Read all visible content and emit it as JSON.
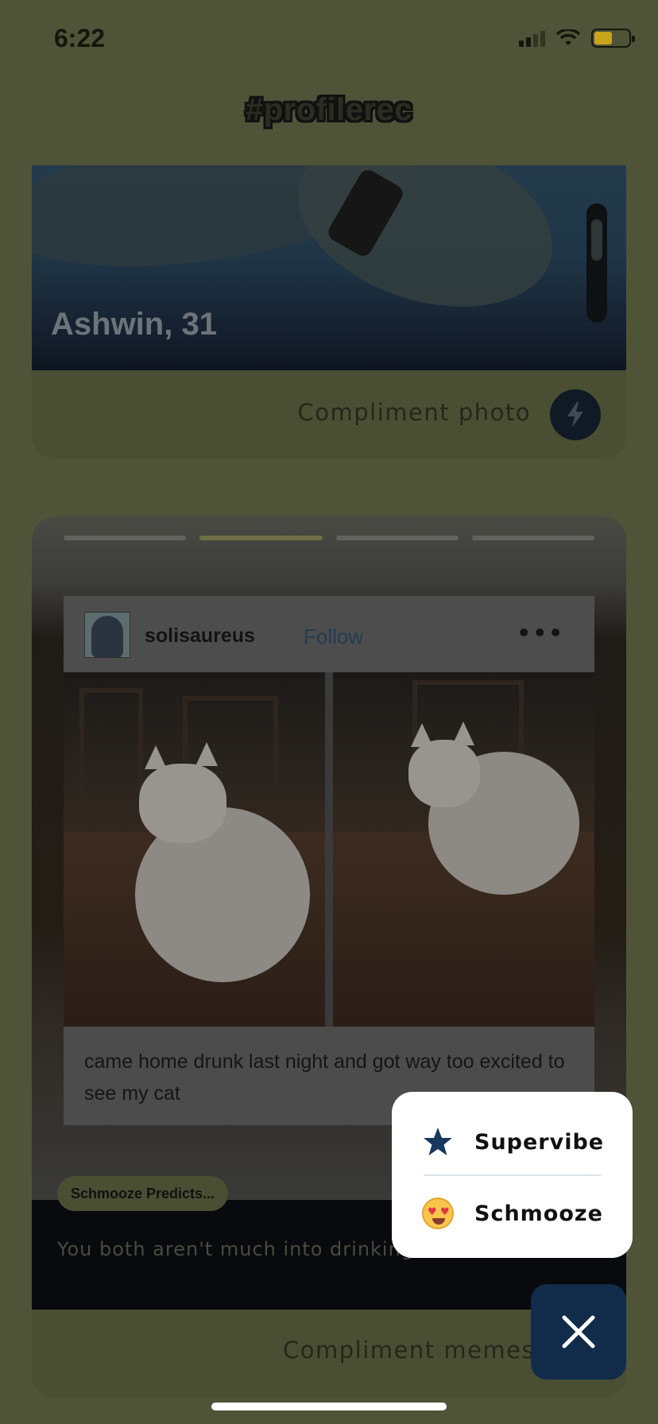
{
  "status_bar": {
    "time": "6:22"
  },
  "header": {
    "title": "#profilerec"
  },
  "profile_card": {
    "name_age": "Ashwin, 31",
    "compliment_label": "Compliment photo"
  },
  "meme_card": {
    "post": {
      "username": "solisaureus",
      "follow_label": "Follow",
      "more_label": "•••",
      "caption": "came home drunk last night and got way too excited to see my cat"
    },
    "prediction_badge": "Schmooze Predicts...",
    "prediction_text": "You both aren't much into drinking",
    "compliment_label": "Compliment memes"
  },
  "reaction_popup": {
    "items": [
      {
        "label": "Supervibe",
        "icon": "star-icon"
      },
      {
        "label": "Schmooze",
        "icon": "heart-eyes-emoji-icon"
      }
    ]
  },
  "colors": {
    "accent_navy": "#102c4a",
    "overlay_olive": "#4f5338",
    "active_story_bar": "#6c7044"
  },
  "story_progress": {
    "total_segments": 4,
    "active_segment": 2
  }
}
